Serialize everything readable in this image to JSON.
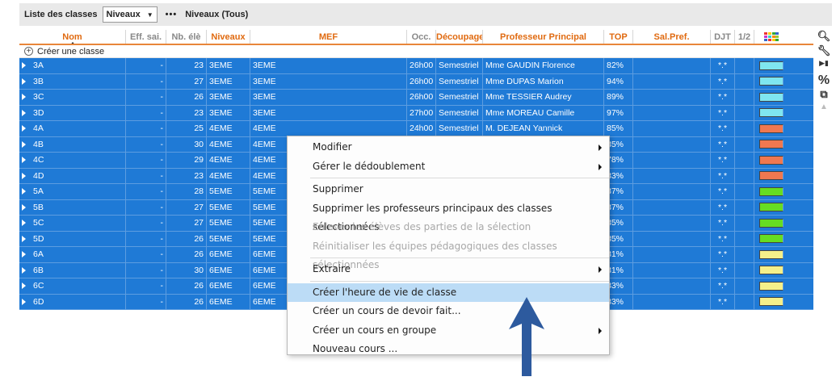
{
  "toolbar": {
    "title": "Liste des classes",
    "select_value": "Niveaux",
    "more": "•••",
    "filter": "Niveaux (Tous)"
  },
  "columns": {
    "nom": "Nom",
    "eff": "Eff. sai.",
    "nb": "Nb. élè",
    "niveaux": "Niveaux",
    "mef": "MEF",
    "occ": "Occ.",
    "decoupage": "Découpage",
    "prof": "Professeur Principal",
    "top": "TOP",
    "salpref": "Sal.Pref.",
    "djt": "DJT",
    "half": "1/2"
  },
  "create_label": "Créer une classe",
  "rows": [
    {
      "nom": "3A",
      "eff": "-",
      "nb": "23",
      "niv": "3EME",
      "mef": "3EME",
      "occ": "26h00",
      "dec": "Semestriel",
      "prof": "Mme GAUDIN Florence",
      "top": "82%",
      "sal": "",
      "djt": "*.*",
      "color": "#7fe6f0"
    },
    {
      "nom": "3B",
      "eff": "-",
      "nb": "27",
      "niv": "3EME",
      "mef": "3EME",
      "occ": "26h00",
      "dec": "Semestriel",
      "prof": "Mme DUPAS Marion",
      "top": "94%",
      "sal": "",
      "djt": "*.*",
      "color": "#7fe6f0"
    },
    {
      "nom": "3C",
      "eff": "-",
      "nb": "26",
      "niv": "3EME",
      "mef": "3EME",
      "occ": "26h00",
      "dec": "Semestriel",
      "prof": "Mme TESSIER Audrey",
      "top": "89%",
      "sal": "",
      "djt": "*.*",
      "color": "#7fe6f0"
    },
    {
      "nom": "3D",
      "eff": "-",
      "nb": "23",
      "niv": "3EME",
      "mef": "3EME",
      "occ": "27h00",
      "dec": "Semestriel",
      "prof": "Mme MOREAU Camille",
      "top": "97%",
      "sal": "",
      "djt": "*.*",
      "color": "#7fe6f0"
    },
    {
      "nom": "4A",
      "eff": "-",
      "nb": "25",
      "niv": "4EME",
      "mef": "4EME",
      "occ": "24h00",
      "dec": "Semestriel",
      "prof": "M. DEJEAN Yannick",
      "top": "85%",
      "sal": "",
      "djt": "*.*",
      "color": "#f07850"
    },
    {
      "nom": "4B",
      "eff": "-",
      "nb": "30",
      "niv": "4EME",
      "mef": "4EME",
      "occ": "",
      "dec": "",
      "prof": "",
      "top": "85%",
      "sal": "",
      "djt": "*.*",
      "color": "#f07850"
    },
    {
      "nom": "4C",
      "eff": "-",
      "nb": "29",
      "niv": "4EME",
      "mef": "4EME",
      "occ": "",
      "dec": "",
      "prof": "",
      "top": "78%",
      "sal": "",
      "djt": "*.*",
      "color": "#f07850"
    },
    {
      "nom": "4D",
      "eff": "-",
      "nb": "23",
      "niv": "4EME",
      "mef": "4EME",
      "occ": "",
      "dec": "",
      "prof": "",
      "top": "83%",
      "sal": "",
      "djt": "*.*",
      "color": "#f07850"
    },
    {
      "nom": "5A",
      "eff": "-",
      "nb": "28",
      "niv": "5EME",
      "mef": "5EME",
      "occ": "",
      "dec": "",
      "prof": "",
      "top": "87%",
      "sal": "",
      "djt": "*.*",
      "color": "#66dd22"
    },
    {
      "nom": "5B",
      "eff": "-",
      "nb": "27",
      "niv": "5EME",
      "mef": "5EME",
      "occ": "",
      "dec": "",
      "prof": "",
      "top": "87%",
      "sal": "",
      "djt": "*.*",
      "color": "#66dd22"
    },
    {
      "nom": "5C",
      "eff": "-",
      "nb": "27",
      "niv": "5EME",
      "mef": "5EME",
      "occ": "",
      "dec": "",
      "prof": "",
      "top": "85%",
      "sal": "",
      "djt": "*.*",
      "color": "#66dd22"
    },
    {
      "nom": "5D",
      "eff": "-",
      "nb": "26",
      "niv": "5EME",
      "mef": "5EME",
      "occ": "",
      "dec": "",
      "prof": "",
      "top": "85%",
      "sal": "",
      "djt": "*.*",
      "color": "#66dd22"
    },
    {
      "nom": "6A",
      "eff": "-",
      "nb": "26",
      "niv": "6EME",
      "mef": "6EME",
      "occ": "",
      "dec": "",
      "prof": "",
      "top": "81%",
      "sal": "",
      "djt": "*.*",
      "color": "#f5f08a"
    },
    {
      "nom": "6B",
      "eff": "-",
      "nb": "30",
      "niv": "6EME",
      "mef": "6EME",
      "occ": "",
      "dec": "",
      "prof": "",
      "top": "81%",
      "sal": "",
      "djt": "*.*",
      "color": "#f5f08a"
    },
    {
      "nom": "6C",
      "eff": "-",
      "nb": "26",
      "niv": "6EME",
      "mef": "6EME",
      "occ": "",
      "dec": "",
      "prof": "",
      "top": "83%",
      "sal": "",
      "djt": "*.*",
      "color": "#f5f08a"
    },
    {
      "nom": "6D",
      "eff": "-",
      "nb": "26",
      "niv": "6EME",
      "mef": "6EME",
      "occ": "",
      "dec": "",
      "prof": "",
      "top": "83%",
      "sal": "",
      "djt": "*.*",
      "color": "#f5f08a"
    }
  ],
  "context_menu": [
    {
      "label": "Modifier",
      "submenu": true,
      "disabled": false
    },
    {
      "label": "Gérer le dédoublement",
      "submenu": true,
      "disabled": false
    },
    {
      "sep": true
    },
    {
      "label": "Supprimer",
      "submenu": false,
      "disabled": false
    },
    {
      "label": "Supprimer les professeurs principaux des classes sélectionnées",
      "submenu": false,
      "disabled": false
    },
    {
      "label": "Enlever les élèves des parties de la sélection",
      "submenu": false,
      "disabled": true
    },
    {
      "label": "Réinitialiser les équipes pédagogiques des classes sélectionnées",
      "submenu": false,
      "disabled": true
    },
    {
      "sep": true
    },
    {
      "label": "Extraire",
      "submenu": true,
      "disabled": false
    },
    {
      "sep": true
    },
    {
      "label": "Créer l'heure de vie de classe",
      "submenu": false,
      "disabled": false,
      "highlight": true
    },
    {
      "label": "Créer un cours de devoir fait...",
      "submenu": false,
      "disabled": false
    },
    {
      "label": "Créer un cours en groupe",
      "submenu": true,
      "disabled": false
    },
    {
      "label": "Nouveau cours ...",
      "submenu": false,
      "disabled": false
    }
  ],
  "right_tools": [
    "search-icon",
    "wrench-icon",
    "play-step-icon",
    "percent-icon",
    "copy-icon",
    "scroll-up-icon"
  ],
  "colors": {
    "selection": "#1f7ad6",
    "header_text": "#e06a10",
    "menu_highlight": "#bcdcf6",
    "arrow": "#2d5a9e"
  }
}
